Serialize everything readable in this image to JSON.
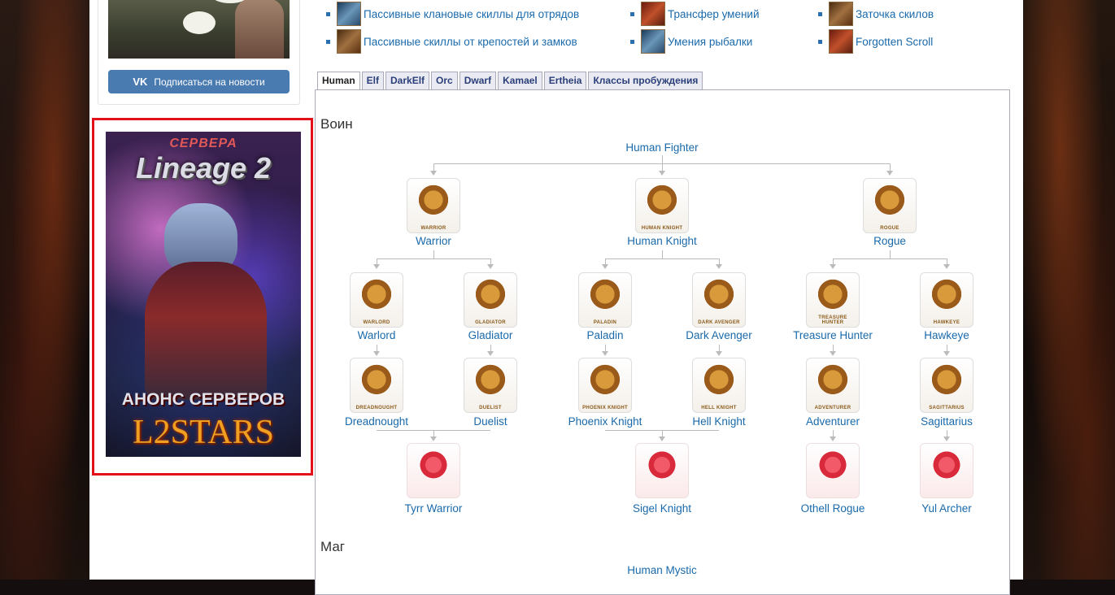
{
  "sidebar": {
    "vk_logo": "VK",
    "vk_button": "Подписаться на новости",
    "banner": {
      "top": "СЕРВЕРА",
      "title": "Lineage 2",
      "subtitle": "АНОНС СЕРВЕРОВ",
      "brand": "L2STARS"
    }
  },
  "links": [
    {
      "label": "Пассивные клановые скиллы для отрядов",
      "icon": "sword-scroll-icon",
      "color": "blue"
    },
    {
      "label": "Пассивные скиллы от крепостей и замков",
      "icon": "castle-scroll-icon",
      "color": "brown"
    },
    {
      "label": "Трансфер умений",
      "icon": "transfer-icon",
      "color": "red"
    },
    {
      "label": "Умения рыбалки",
      "icon": "fishing-icon",
      "color": "blue"
    },
    {
      "label": "Заточка скилов",
      "icon": "enchant-book-icon",
      "color": "brown"
    },
    {
      "label": "Forgotten Scroll",
      "icon": "forgotten-scroll-icon",
      "color": "red"
    }
  ],
  "tabs": [
    "Human",
    "Elf",
    "DarkElf",
    "Orc",
    "Dwarf",
    "Kamael",
    "Ertheia",
    "Классы пробуждения"
  ],
  "active_tab": "Human",
  "sections": {
    "fighter": "Воин",
    "mystic": "Маг"
  },
  "tree": {
    "root": "Human Fighter",
    "mystic_root": "Human Mystic",
    "first": [
      {
        "label": "Warrior",
        "cap": "WARRIOR"
      },
      {
        "label": "Human Knight",
        "cap": "HUMAN KNIGHT"
      },
      {
        "label": "Rogue",
        "cap": "ROGUE"
      }
    ],
    "second": [
      {
        "label": "Warlord",
        "cap": "WARLORD"
      },
      {
        "label": "Gladiator",
        "cap": "GLADIATOR"
      },
      {
        "label": "Paladin",
        "cap": "PALADIN"
      },
      {
        "label": "Dark Avenger",
        "cap": "DARK AVENGER"
      },
      {
        "label": "Treasure Hunter",
        "cap": "TREASURE HUNTER"
      },
      {
        "label": "Hawkeye",
        "cap": "HAWKEYE"
      }
    ],
    "third": [
      {
        "label": "Dreadnought",
        "cap": "DREADNOUGHT"
      },
      {
        "label": "Duelist",
        "cap": "DUELIST"
      },
      {
        "label": "Phoenix Knight",
        "cap": "PHOENIX KNIGHT"
      },
      {
        "label": "Hell Knight",
        "cap": "HELL KNIGHT"
      },
      {
        "label": "Adventurer",
        "cap": "ADVENTURER"
      },
      {
        "label": "Sagittarius",
        "cap": "SAGITTARIUS"
      }
    ],
    "awakened": [
      {
        "label": "Tyrr Warrior"
      },
      {
        "label": "Sigel Knight"
      },
      {
        "label": "Othell Rogue"
      },
      {
        "label": "Yul Archer"
      }
    ]
  }
}
